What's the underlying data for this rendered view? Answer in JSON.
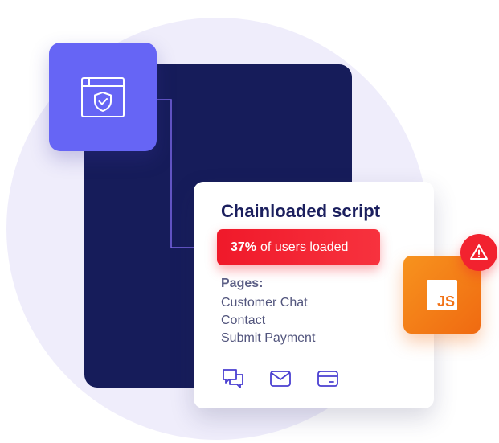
{
  "card": {
    "title": "Chainloaded script",
    "load_status": {
      "percent": "37%",
      "text": "of users loaded"
    },
    "pages_label": "Pages:",
    "pages": [
      "Customer Chat",
      "Contact",
      "Submit Payment"
    ],
    "actions": [
      {
        "icon": "chat-icon"
      },
      {
        "icon": "mail-icon"
      },
      {
        "icon": "card-icon"
      }
    ]
  },
  "js_tile": {
    "label": "JS"
  },
  "icons": {
    "shield_tile": "browser-shield-icon",
    "alert": "warning-icon"
  },
  "colors": {
    "background_circle": "#efedfb",
    "dark_panel": "#161c5a",
    "accent_purple": "#6665f5",
    "alert_red": "#f2222f",
    "js_orange": "#f17216",
    "title_navy": "#1b1f5e"
  }
}
